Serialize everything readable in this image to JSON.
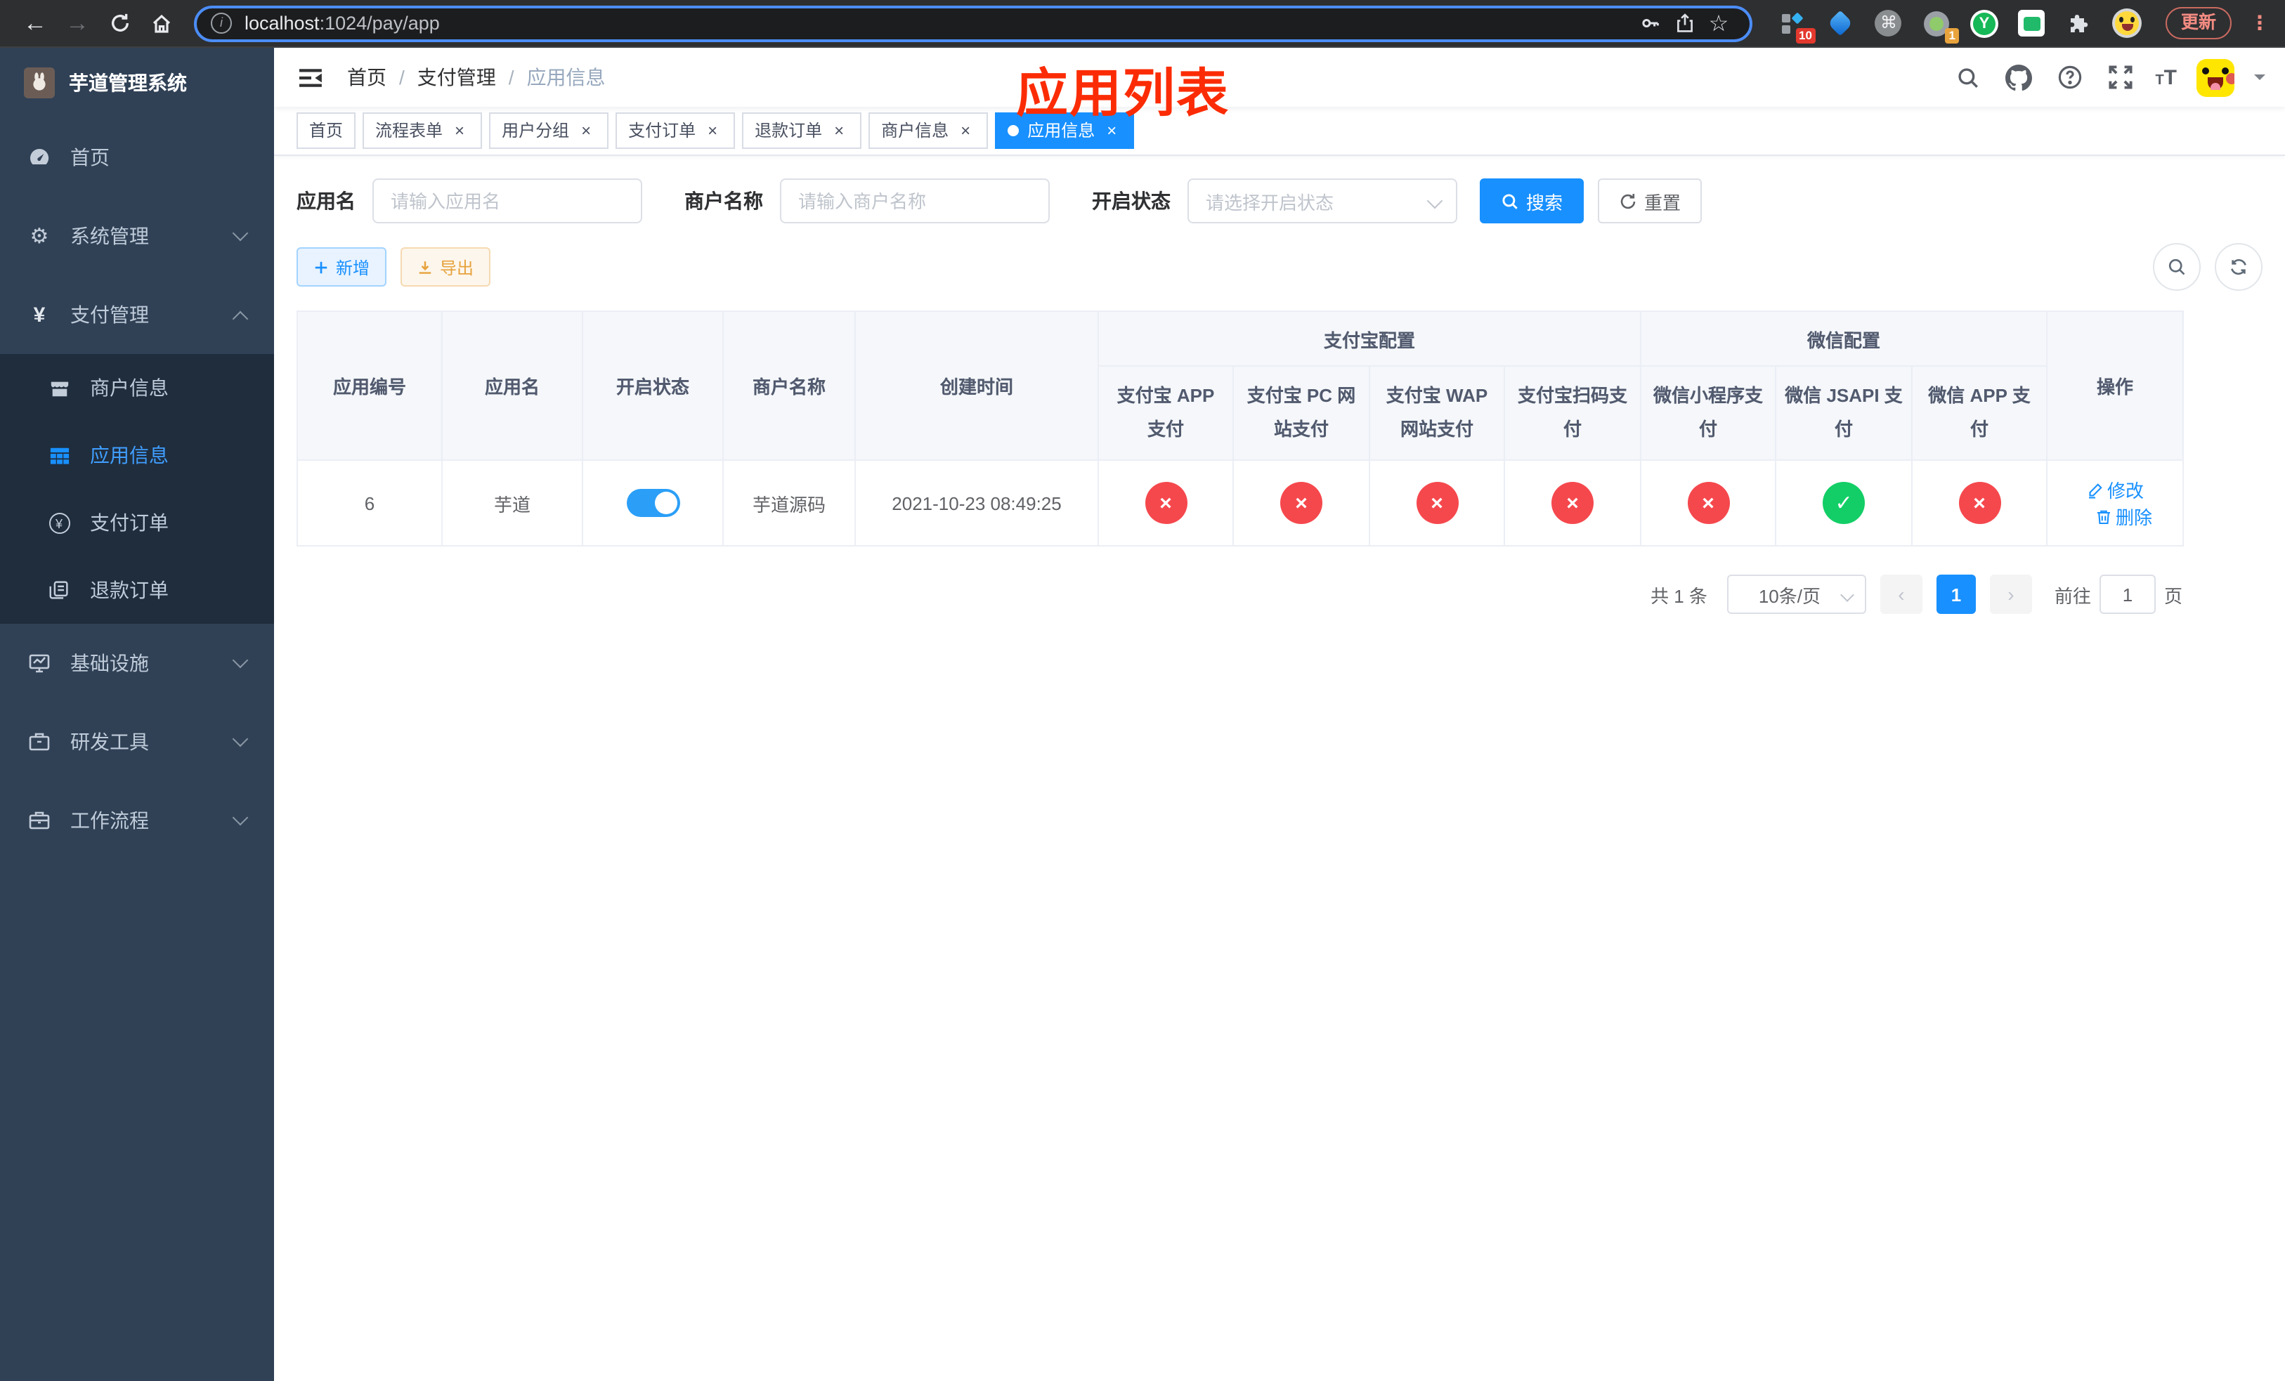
{
  "colors": {
    "theme": "#1890ff",
    "menu_active": "#409eff",
    "success": "#13ce66",
    "danger": "#f5484d",
    "annotation": "#fb2c05",
    "toggle_on": "#2b9ff7"
  },
  "browser": {
    "url_domain": "localhost",
    "url_path": ":1024/pay/app",
    "update_label": "更新",
    "ext_badges": {
      "pinned": "10",
      "tasks": "1"
    }
  },
  "sidebar": {
    "title": "芋道管理系统",
    "items": [
      {
        "label": "首页"
      },
      {
        "label": "系统管理"
      },
      {
        "label": "支付管理"
      },
      {
        "label": "商户信息"
      },
      {
        "label": "应用信息"
      },
      {
        "label": "支付订单"
      },
      {
        "label": "退款订单"
      },
      {
        "label": "基础设施"
      },
      {
        "label": "研发工具"
      },
      {
        "label": "工作流程"
      }
    ]
  },
  "header": {
    "breadcrumb": [
      "首页",
      "支付管理",
      "应用信息"
    ],
    "annotation": "应用列表"
  },
  "tabs": [
    {
      "label": "首页"
    },
    {
      "label": "流程表单"
    },
    {
      "label": "用户分组"
    },
    {
      "label": "支付订单"
    },
    {
      "label": "退款订单"
    },
    {
      "label": "商户信息"
    },
    {
      "label": "应用信息"
    }
  ],
  "filters": {
    "app_name": {
      "label": "应用名",
      "placeholder": "请输入应用名",
      "value": ""
    },
    "merchant_name": {
      "label": "商户名称",
      "placeholder": "请输入商户名称",
      "value": ""
    },
    "status": {
      "label": "开启状态",
      "placeholder": "请选择开启状态",
      "value": ""
    },
    "search_label": "搜索",
    "reset_label": "重置"
  },
  "toolbar": {
    "add_label": "新增",
    "export_label": "导出"
  },
  "table": {
    "group_headers": {
      "alipay": "支付宝配置",
      "wechat": "微信配置"
    },
    "columns": [
      "应用编号",
      "应用名",
      "开启状态",
      "商户名称",
      "创建时间",
      "支付宝 APP 支付",
      "支付宝 PC 网站支付",
      "支付宝 WAP 网站支付",
      "支付宝扫码支付",
      "微信小程序支付",
      "微信 JSAPI 支付",
      "微信 APP 支付",
      "操作"
    ],
    "row": {
      "id": "6",
      "name": "芋道",
      "enabled": true,
      "merchant": "芋道源码",
      "created_at": "2021-10-23 08:49:25",
      "statuses": [
        false,
        false,
        false,
        false,
        false,
        true,
        false
      ]
    },
    "actions": {
      "edit": "修改",
      "delete": "删除"
    }
  },
  "pagination": {
    "total": "共 1 条",
    "page_size": "10条/页",
    "current": "1",
    "goto_label": "前往",
    "goto_value": "1",
    "unit": "页"
  }
}
